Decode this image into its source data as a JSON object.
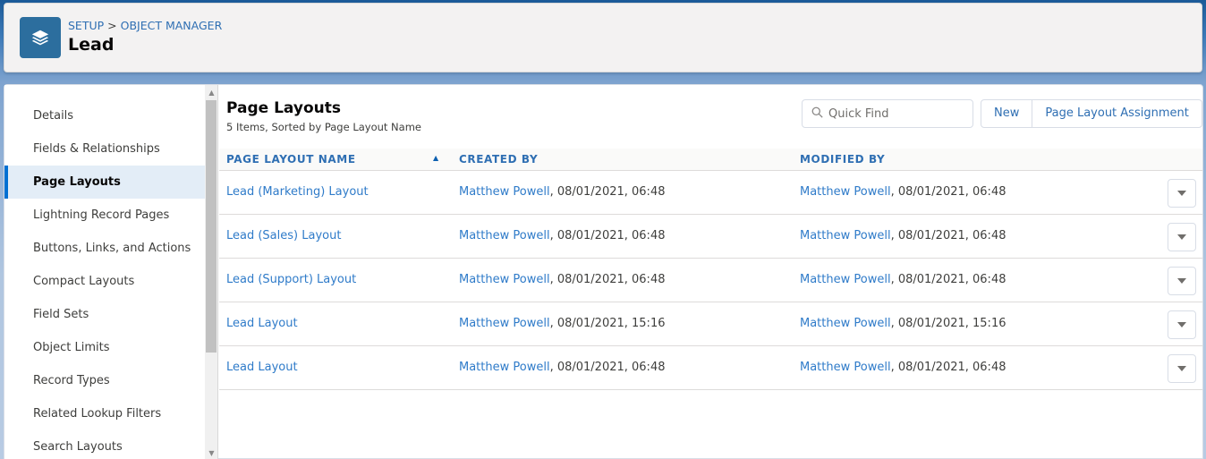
{
  "header": {
    "icon": "layers-icon",
    "breadcrumb": [
      "SETUP",
      "OBJECT MANAGER"
    ],
    "breadcrumb_separator": ">",
    "title": "Lead",
    "icon_color": "#2c6e9e"
  },
  "sidebar": {
    "items": [
      {
        "label": "Details",
        "active": false
      },
      {
        "label": "Fields & Relationships",
        "active": false
      },
      {
        "label": "Page Layouts",
        "active": true
      },
      {
        "label": "Lightning Record Pages",
        "active": false
      },
      {
        "label": "Buttons, Links, and Actions",
        "active": false
      },
      {
        "label": "Compact Layouts",
        "active": false
      },
      {
        "label": "Field Sets",
        "active": false
      },
      {
        "label": "Object Limits",
        "active": false
      },
      {
        "label": "Record Types",
        "active": false
      },
      {
        "label": "Related Lookup Filters",
        "active": false
      },
      {
        "label": "Search Layouts",
        "active": false
      }
    ],
    "active_accent": "#0070d2"
  },
  "main": {
    "title": "Page Layouts",
    "subtitle": "5 Items, Sorted by Page Layout Name",
    "quick_find_placeholder": "Quick Find",
    "buttons": {
      "new": "New",
      "assignment": "Page Layout Assignment"
    },
    "columns": [
      "PAGE LAYOUT NAME",
      "CREATED BY",
      "MODIFIED BY"
    ],
    "sort": {
      "column": "PAGE LAYOUT NAME",
      "direction": "ascending"
    },
    "rows": [
      {
        "name": "Lead (Marketing) Layout",
        "created_user": "Matthew Powell",
        "created_at": ", 08/01/2021, 06:48",
        "modified_user": "Matthew Powell",
        "modified_at": ", 08/01/2021, 06:48"
      },
      {
        "name": "Lead (Sales) Layout",
        "created_user": "Matthew Powell",
        "created_at": ", 08/01/2021, 06:48",
        "modified_user": "Matthew Powell",
        "modified_at": ", 08/01/2021, 06:48"
      },
      {
        "name": "Lead (Support) Layout",
        "created_user": "Matthew Powell",
        "created_at": ", 08/01/2021, 06:48",
        "modified_user": "Matthew Powell",
        "modified_at": ", 08/01/2021, 06:48"
      },
      {
        "name": "Lead Layout",
        "created_user": "Matthew Powell",
        "created_at": ", 08/01/2021, 15:16",
        "modified_user": "Matthew Powell",
        "modified_at": ", 08/01/2021, 15:16"
      },
      {
        "name": "Lead Layout",
        "created_user": "Matthew Powell",
        "created_at": ", 08/01/2021, 06:48",
        "modified_user": "Matthew Powell",
        "modified_at": ", 08/01/2021, 06:48"
      }
    ]
  }
}
